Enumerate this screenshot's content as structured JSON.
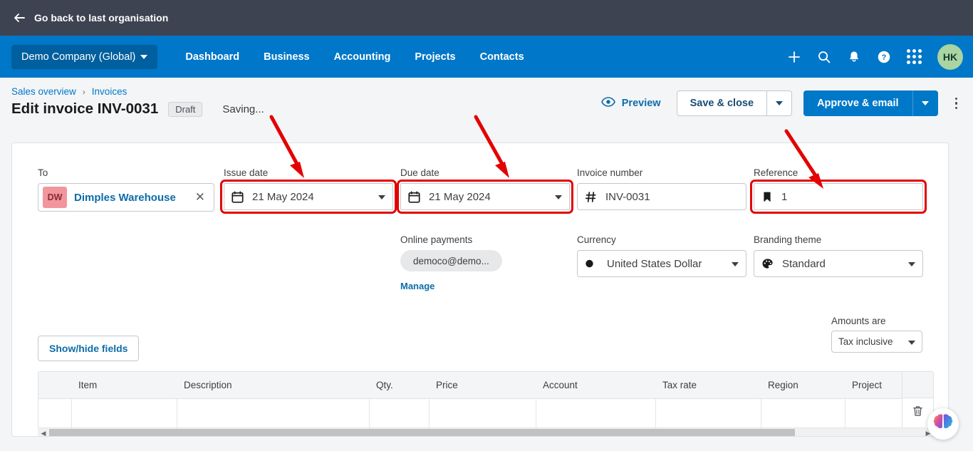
{
  "topbar": {
    "back_label": "Go back to last organisation",
    "back_icon": "arrow-left-icon",
    "bg": "#3d4351"
  },
  "nav": {
    "org_name": "Demo Company (Global)",
    "links": [
      "Dashboard",
      "Business",
      "Accounting",
      "Projects",
      "Contacts"
    ],
    "icons": [
      "plus-icon",
      "search-icon",
      "bell-icon",
      "help-icon",
      "apps-grid-icon"
    ],
    "avatar_initials": "HK",
    "bg": "#0077c8",
    "org_chip_bg": "#005f9e",
    "avatar_bg": "#a8d5a2"
  },
  "breadcrumb": {
    "items": [
      "Sales overview",
      "Invoices"
    ],
    "separator": "›"
  },
  "header": {
    "title": "Edit invoice INV-0031",
    "status_badge": "Draft",
    "saving_text": "Saving...",
    "preview_label": "Preview",
    "preview_icon": "eye-icon",
    "save_close_label": "Save & close",
    "approve_email_label": "Approve & email",
    "more_icon": "kebab-menu-icon",
    "primary_color": "#0078c8"
  },
  "form": {
    "to": {
      "label": "To",
      "initials": "DW",
      "contact": "Dimples Warehouse",
      "clear_icon": "close-icon"
    },
    "issue_date": {
      "label": "Issue date",
      "value": "21 May 2024",
      "icon": "calendar-icon",
      "highlighted": true
    },
    "due_date": {
      "label": "Due date",
      "value": "21 May 2024",
      "icon": "calendar-icon",
      "highlighted": true
    },
    "invoice_number": {
      "label": "Invoice number",
      "value": "INV-0031",
      "icon": "hash-icon",
      "highlighted": false
    },
    "reference": {
      "label": "Reference",
      "value": "1",
      "icon": "bookmark-icon",
      "highlighted": true
    },
    "online_payments": {
      "label": "Online payments",
      "value": "democo@demo...",
      "manage_label": "Manage"
    },
    "currency": {
      "label": "Currency",
      "value": "United States Dollar",
      "icon": "currency-icon"
    },
    "branding_theme": {
      "label": "Branding theme",
      "value": "Standard",
      "icon": "palette-icon"
    },
    "show_hide_fields_label": "Show/hide fields",
    "amounts_are": {
      "label": "Amounts are",
      "value": "Tax inclusive"
    }
  },
  "line_items": {
    "columns": [
      "Item",
      "Description",
      "Qty.",
      "Price",
      "Account",
      "Tax rate",
      "Region",
      "Project"
    ],
    "rows": [
      {
        "item": "",
        "description": "",
        "qty": "",
        "price": "",
        "account": "",
        "tax_rate": "",
        "region": "",
        "project": ""
      }
    ],
    "delete_icon": "trash-icon"
  },
  "scrollbar": {
    "left_arrow": "◀",
    "right_arrow": "▶"
  },
  "floating_widget": {
    "icon": "brain-icon"
  },
  "annotations": {
    "color": "#e30000",
    "arrows": [
      {
        "target": "issue-date-field"
      },
      {
        "target": "due-date-field"
      },
      {
        "target": "reference-field"
      }
    ]
  }
}
